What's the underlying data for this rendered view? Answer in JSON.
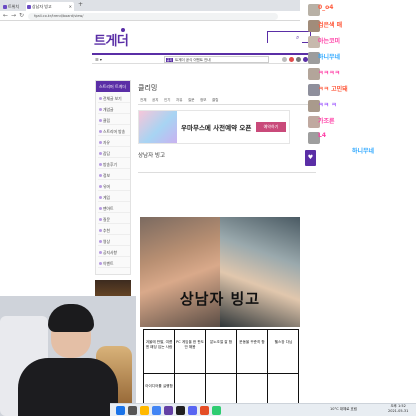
{
  "browser": {
    "tabs": [
      "트위치",
      "상남자 빙고"
    ],
    "url": "fgall.co.kr/trend/board/view/"
  },
  "site": {
    "logo": "트게더",
    "search_placeholder": "",
    "nav_notice": "트게더 공식 이벤트 안내",
    "nav_notice_badge": "공지"
  },
  "sidebar": {
    "header": "스트리머 트게더",
    "items": [
      "전체글 보기",
      "개념글",
      "클립",
      "스트리머 방송",
      "자유",
      "잡담",
      "방송후기",
      "정보",
      "유머",
      "게임",
      "팬아트",
      "질문",
      "추천",
      "영상",
      "공지사항",
      "이벤트",
      "건의"
    ]
  },
  "sidead": {
    "title": "오딘",
    "button": "PLAY NOW"
  },
  "board": {
    "title": "클리밍",
    "subtitle": "",
    "tabs": [
      "전체",
      "공지",
      "인기",
      "자유",
      "질문",
      "정보",
      "클립"
    ]
  },
  "banner": {
    "text": "우마무스메 사전예약 오픈",
    "button": "예약하기"
  },
  "post": {
    "title": "상남자 빙고",
    "meta_left": "",
    "meta_right": "",
    "link_text": "",
    "body_text": "",
    "hero_title": "상남자 빙고",
    "bingo_cells": [
      "겨울에 반팔, 여름엔 패딩 입는 사람",
      "PC 게임을 한 판도 안 해봄",
      "분노조절 잘 함",
      "운동을 꾸준히 함",
      "헬스장 다님",
      "아이디어를 실행함",
      "",
      "",
      "",
      ""
    ]
  },
  "chat": {
    "lines": [
      {
        "user": "0_o4",
        "color": "#ff5a3c"
      },
      {
        "user": "검은색 매",
        "color": "#ff5a3c"
      },
      {
        "user": "아는코미",
        "color": "#ff3ca5"
      },
      {
        "user": "하니무네",
        "color": "#2fa8ff"
      },
      {
        "user": "ㅋㅋㅋㅋ",
        "color": "#ff3ca5"
      },
      {
        "user": "ㅋㅋ 고민돼",
        "color": "#ff5a3c"
      },
      {
        "user": "ㅋㅋ ㅋ",
        "color": "#a05cff"
      },
      {
        "user": "가조른",
        "color": "#ff3ca5"
      },
      {
        "user": "L4",
        "color": "#ff3ca5"
      },
      {
        "user": "하니무네",
        "color": "#2fa8ff"
      }
    ]
  },
  "taskbar": {
    "weather": "10°C 대체로 흐림",
    "time": "오후 1:52",
    "date": "2021-05-31"
  }
}
